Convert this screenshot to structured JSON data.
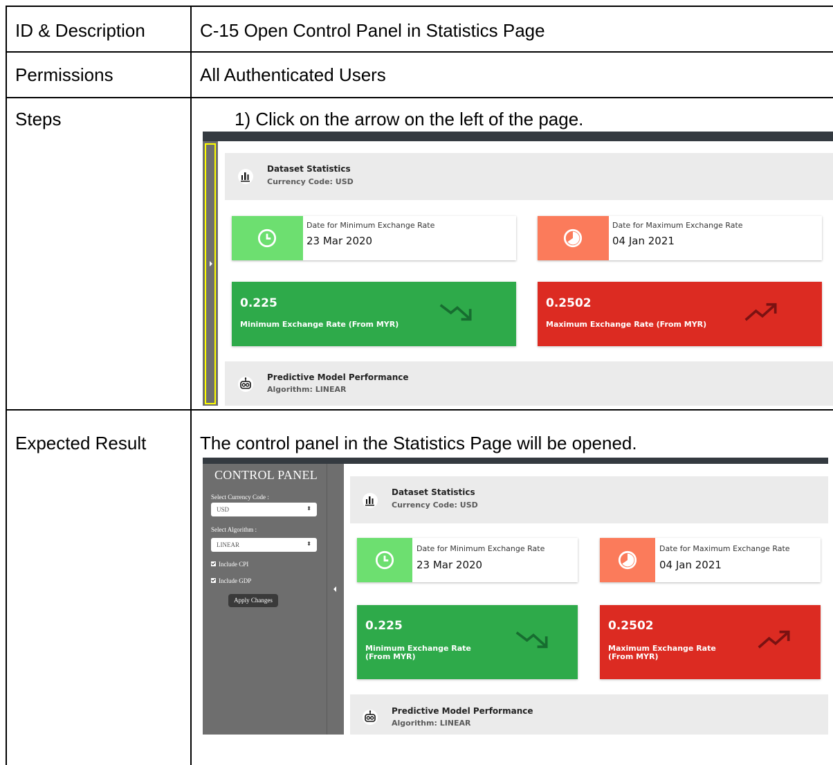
{
  "table": {
    "rows": [
      {
        "label": "ID & Description",
        "value": "C-15 Open Control Panel in Statistics Page"
      },
      {
        "label": "Permissions",
        "value": "All Authenticated Users"
      },
      {
        "label": "Steps",
        "value": "1)  Click on the arrow on the left of the page."
      },
      {
        "label": "Expected Result",
        "value": "The control panel in the Statistics Page will be opened."
      }
    ]
  },
  "dashboard": {
    "dataset_title": "Dataset Statistics",
    "dataset_sub": "Currency Code: USD",
    "min_date_label": "Date for Minimum Exchange Rate",
    "min_date_value": "23 Mar 2020",
    "max_date_label": "Date for Maximum Exchange Rate",
    "max_date_value": "04 Jan 2021",
    "min_rate_value": "0.225",
    "min_rate_label": "Minimum Exchange Rate (From MYR)",
    "min_rate_label_l1": "Minimum Exchange Rate",
    "min_rate_label_l2": "(From MYR)",
    "max_rate_value": "0.2502",
    "max_rate_label": "Maximum Exchange Rate (From MYR)",
    "max_rate_label_l1": "Maximum Exchange Rate",
    "max_rate_label_l2": "(From MYR)",
    "model_title": "Predictive Model Performance",
    "model_sub": "Algorithm: LINEAR"
  },
  "control_panel": {
    "title": "CONTROL PANEL",
    "currency_label": "Select Currency Code :",
    "currency_value": "USD",
    "algorithm_label": "Select Algorithm :",
    "algorithm_value": "LINEAR",
    "include_cpi": "Include CPI",
    "include_gdp": "Include GDP",
    "apply_button": "Apply Changes"
  },
  "colors": {
    "green_light": "#6ddf70",
    "green_dark": "#2eaa4a",
    "salmon": "#fb7b5b",
    "red": "#dc2b22",
    "highlight": "#ffff00"
  }
}
